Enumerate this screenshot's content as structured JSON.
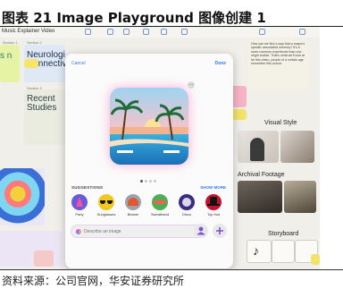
{
  "caption": {
    "title": "图表 21 Image Playground  图像创建 1"
  },
  "footer": {
    "source": "资料来源：公司官网，华安证券研究所"
  },
  "app": {
    "window_title": "Music Explainer Video",
    "board": {
      "section_labels": [
        "Section 1",
        "Section 2",
        "Section 3",
        "Section 4"
      ],
      "card_neuro": "Neurologic Connective",
      "card_recent": "Recent Studies",
      "card_left_fragment": "s n",
      "question_note": "How can we find a way that a mayor's specific associated memory? It's a more common experience than one might realize. That's what we'll look at for this video, people of a certain age remember this sound.",
      "visual_style": "Visual Style",
      "archival_footage": "Archival Footage",
      "storyboard": "Storyboard"
    }
  },
  "modal": {
    "cancel": "Cancel",
    "done": "Done",
    "more_glyph": "…",
    "suggestions_heading": "SUGGESTIONS",
    "show_more": "SHOW MORE",
    "suggestions": [
      {
        "label": "Party",
        "color": "#6a5bd6",
        "icon": "party-icon"
      },
      {
        "label": "Sunglasses",
        "color": "#f2c623",
        "icon": "sunglasses-icon"
      },
      {
        "label": "Beanie",
        "color": "#9aa3ad",
        "icon": "beanie-icon"
      },
      {
        "label": "Sweatband",
        "color": "#4caf50",
        "icon": "sweatband-icon"
      },
      {
        "label": "Disco",
        "color": "#3b2a86",
        "icon": "disco-icon"
      },
      {
        "label": "Top Hat",
        "color": "#c8102e",
        "icon": "top-hat-icon"
      }
    ],
    "prompt_placeholder": "Describe an image",
    "page_count": 4,
    "active_page": 1
  },
  "colors": {
    "accent": "#3478f6"
  }
}
